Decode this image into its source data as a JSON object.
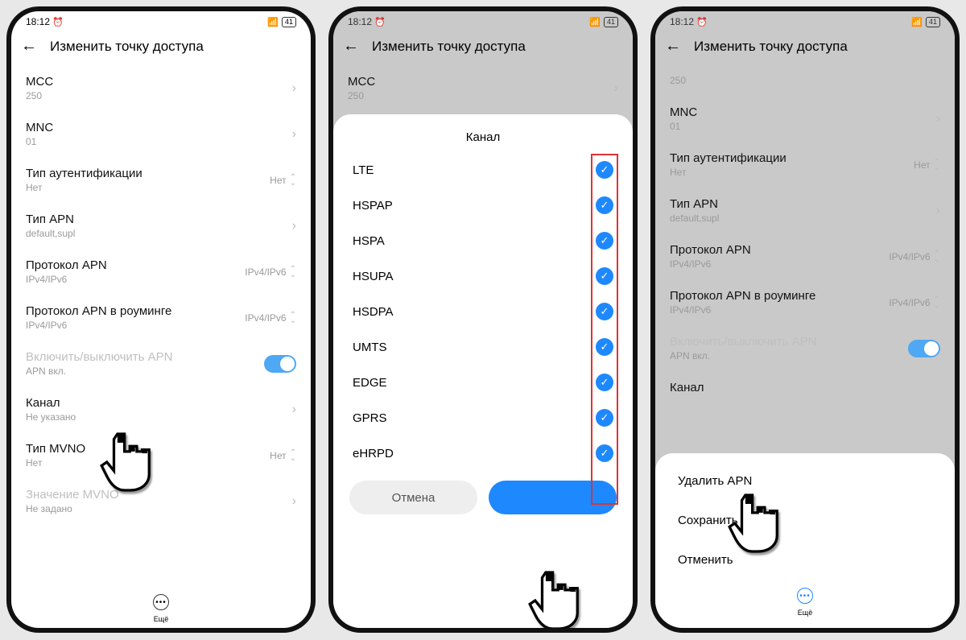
{
  "status": {
    "time": "18:12",
    "battery": "41"
  },
  "header": {
    "title": "Изменить точку доступа"
  },
  "rows": {
    "mcc": {
      "label": "MCC",
      "sub": "250"
    },
    "mnc": {
      "label": "MNC",
      "sub": "01"
    },
    "auth": {
      "label": "Тип аутентификации",
      "sub": "Нет",
      "rval": "Нет"
    },
    "apntype": {
      "label": "Тип APN",
      "sub": "default,supl"
    },
    "proto": {
      "label": "Протокол APN",
      "sub": "IPv4/IPv6",
      "rval": "IPv4/IPv6"
    },
    "roam": {
      "label": "Протокол APN в роуминге",
      "sub": "IPv4/IPv6",
      "rval": "IPv4/IPv6"
    },
    "enable": {
      "label": "Включить/выключить APN",
      "sub": "APN вкл."
    },
    "channel": {
      "label": "Канал",
      "sub": "Не указано"
    },
    "mvno": {
      "label": "Тип MVNO",
      "sub": "Нет",
      "rval": "Нет"
    },
    "mvnoval": {
      "label": "Значение MVNO",
      "sub": "Не задано"
    }
  },
  "more": "Ещё",
  "sheet": {
    "title": "Канал",
    "options": [
      "LTE",
      "HSPAP",
      "HSPA",
      "HSUPA",
      "HSDPA",
      "UMTS",
      "EDGE",
      "GPRS",
      "eHRPD"
    ],
    "cancel": "Отмена"
  },
  "screen3": {
    "mccval": "250"
  },
  "menu": {
    "delete": "Удалить APN",
    "save": "Сохранить",
    "cancel": "Отменить"
  }
}
